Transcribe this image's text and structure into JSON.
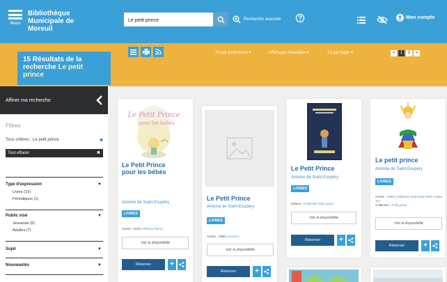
{
  "header": {
    "menu_label": "Menu",
    "brand_lines": [
      "Bibliothèque",
      "Municipale de",
      "Moreuil"
    ],
    "search_value": "Le petit prince",
    "advanced_search": "Recherche avancée",
    "account": "Mon compte"
  },
  "toolbar": {
    "results_count": "15",
    "results_text": "Résultats de la recherche",
    "results_query": "Le petit prince",
    "sort": "Tri par pertinence",
    "display": "Affichage mosaïque",
    "per_page": "12 par page",
    "pager": [
      "«",
      "1",
      "2",
      "»"
    ]
  },
  "sidebar": {
    "refine": "Affiner ma recherche",
    "filters_title": "Filtres",
    "criteria": "Tous critères : Le petit prince",
    "clear_all": "Tout effacer",
    "facets": [
      {
        "label": "Type d'expression",
        "items": [
          "Livres (15)",
          "Périodiques (1)"
        ]
      },
      {
        "label": "Public visé",
        "items": [
          "Jeunesse (9)",
          "Adultes (7)"
        ]
      },
      {
        "label": "Sujet",
        "items": []
      },
      {
        "label": "Nouveautés",
        "items": []
      }
    ]
  },
  "cards": [
    {
      "title_lines": [
        "Le Petit Prince",
        "pour les bébés"
      ],
      "author": "Antoine de Saint-Exupéry",
      "badge": "LIVRES",
      "meta": "Année : 2018 | ",
      "meta_link": "Fleurus Paris |",
      "cover_text": [
        "Le Petit Prince",
        "pour les bébés"
      ],
      "availability": "Voir la disponibilité",
      "reserve": "Réserver"
    },
    {
      "title_lines": [
        "Le Petit Prince"
      ],
      "author": "Antoine de Saint-Exupéry",
      "badge": "LIVRES",
      "meta": "Année : 1985 | ",
      "meta_link": "Accord |",
      "availability": "Voir la disponibilité",
      "reserve": "Réserver"
    },
    {
      "title_lines": [
        "Le Petit Prince"
      ],
      "author": "Antoine de Saint-Exupéry",
      "badge": "LIVRES",
      "meta": "Éditeur : ",
      "meta_link": "Collection Folio junior",
      "availability": "Voir la disponibilité",
      "reserve": "Réserver"
    },
    {
      "title_lines": [
        "Le petit prince"
      ],
      "author": "Antoine de Saint-Exupéry",
      "badge": "LIVRES",
      "meta": "Année : ",
      "meta_link": "1999 | Gallimard Jeunesse Paris Cedex 10 |",
      "meta_line2": "Collection : ",
      "meta_line2_link": "Folio junior",
      "availability": "Voir la disponibilité",
      "reserve": "Réserver"
    }
  ],
  "colors": {
    "header_blue": "#3ba0d8",
    "band_orange": "#eeb23e",
    "dark": "#2c2d2f",
    "reserve_navy": "#235d8e"
  }
}
